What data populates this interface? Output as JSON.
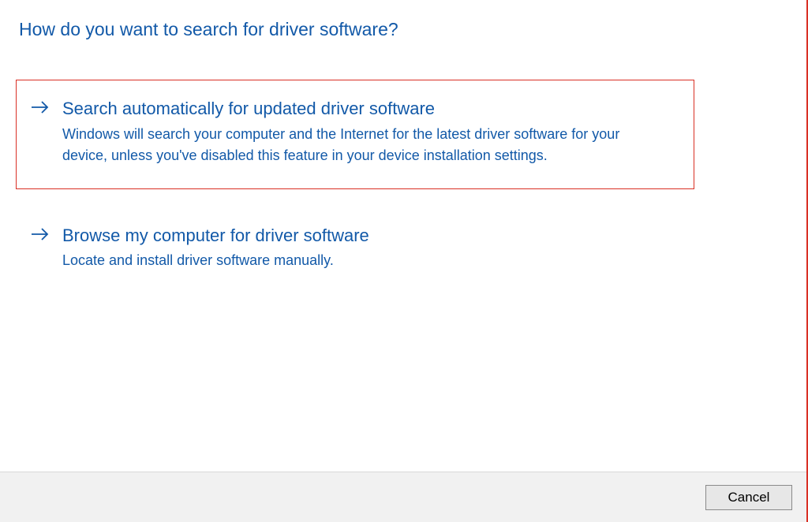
{
  "page": {
    "title": "How do you want to search for driver software?"
  },
  "options": [
    {
      "title": "Search automatically for updated driver software",
      "description": "Windows will search your computer and the Internet for the latest driver software for your device, unless you've disabled this feature in your device installation settings."
    },
    {
      "title": "Browse my computer for driver software",
      "description": "Locate and install driver software manually."
    }
  ],
  "footer": {
    "cancel_label": "Cancel"
  },
  "colors": {
    "link_blue": "#1259a8",
    "highlight_border": "#d93025",
    "footer_bg": "#f1f1f1"
  }
}
